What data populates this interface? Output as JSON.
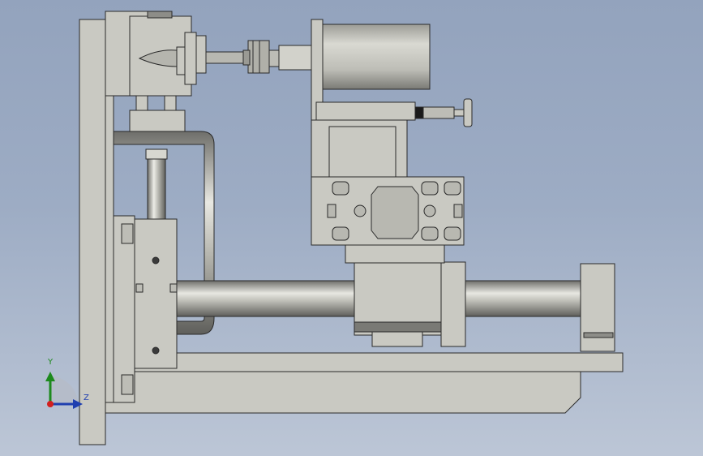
{
  "viewport": {
    "background_top": "#93a3bd",
    "background_bottom": "#bcc6d6",
    "part_fill": "#c9c9c2",
    "part_stroke": "#2a2a2a",
    "shadow_fill": "#8d8d88"
  },
  "triad": {
    "y_label": "Y",
    "z_label": "Z",
    "y_color": "#1d8a1d",
    "z_color": "#1f3fb0",
    "origin_color": "#d21f1f"
  }
}
